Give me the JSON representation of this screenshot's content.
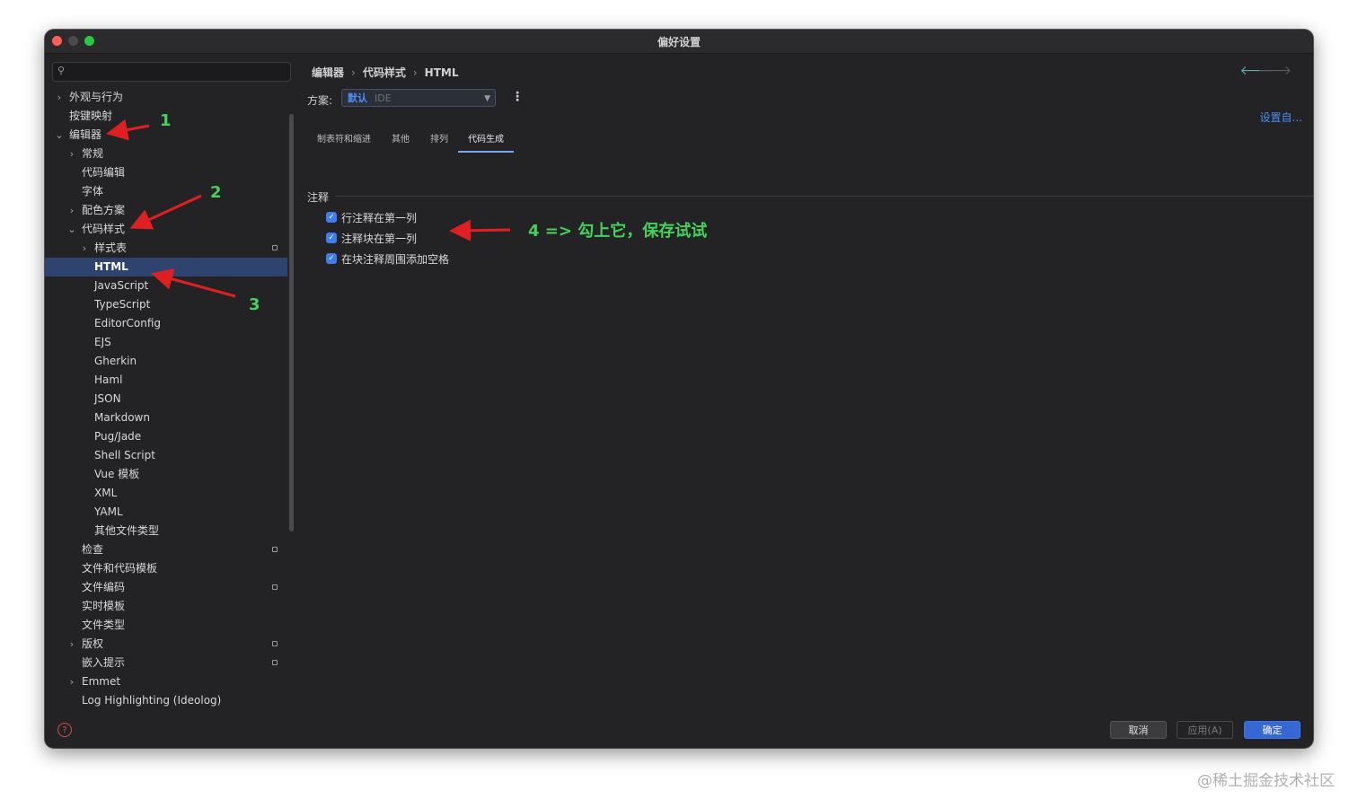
{
  "window": {
    "title": "偏好设置"
  },
  "sidebar": {
    "search": {
      "placeholder": ""
    },
    "items": [
      {
        "label": "外观与行为",
        "chevron": "right"
      },
      {
        "label": "按键映射",
        "chevron": ""
      },
      {
        "label": "编辑器",
        "chevron": "down"
      },
      {
        "label": "常规",
        "chevron": "right"
      },
      {
        "label": "代码编辑",
        "chevron": ""
      },
      {
        "label": "字体",
        "chevron": ""
      },
      {
        "label": "配色方案",
        "chevron": "right"
      },
      {
        "label": "代码样式",
        "chevron": "down"
      },
      {
        "label": "样式表",
        "chevron": "right"
      },
      {
        "label": "HTML",
        "chevron": ""
      },
      {
        "label": "JavaScript",
        "chevron": ""
      },
      {
        "label": "TypeScript",
        "chevron": ""
      },
      {
        "label": "EditorConfig",
        "chevron": ""
      },
      {
        "label": "EJS",
        "chevron": ""
      },
      {
        "label": "Gherkin",
        "chevron": ""
      },
      {
        "label": "Haml",
        "chevron": ""
      },
      {
        "label": "JSON",
        "chevron": ""
      },
      {
        "label": "Markdown",
        "chevron": ""
      },
      {
        "label": "Pug/Jade",
        "chevron": ""
      },
      {
        "label": "Shell Script",
        "chevron": ""
      },
      {
        "label": "Vue 模板",
        "chevron": ""
      },
      {
        "label": "XML",
        "chevron": ""
      },
      {
        "label": "YAML",
        "chevron": ""
      },
      {
        "label": "其他文件类型",
        "chevron": ""
      },
      {
        "label": "检查",
        "chevron": ""
      },
      {
        "label": "文件和代码模板",
        "chevron": ""
      },
      {
        "label": "文件编码",
        "chevron": ""
      },
      {
        "label": "实时模板",
        "chevron": ""
      },
      {
        "label": "文件类型",
        "chevron": ""
      },
      {
        "label": "版权",
        "chevron": "right"
      },
      {
        "label": "嵌入提示",
        "chevron": ""
      },
      {
        "label": "Emmet",
        "chevron": "right"
      },
      {
        "label": "Log Highlighting (Ideolog)",
        "chevron": ""
      }
    ],
    "selected": "HTML"
  },
  "breadcrumb": [
    "编辑器",
    "代码样式",
    "HTML"
  ],
  "scheme": {
    "label": "方案:",
    "value": "默认",
    "suffix": "IDE"
  },
  "set_from": "设置自...",
  "tabs": [
    "制表符和缩进",
    "其他",
    "排列",
    "代码生成"
  ],
  "active_tab": "代码生成",
  "section": {
    "title": "注释"
  },
  "checkboxes": [
    {
      "label": "行注释在第一列",
      "checked": true
    },
    {
      "label": "注释块在第一列",
      "checked": true
    },
    {
      "label": "在块注释周围添加空格",
      "checked": true
    }
  ],
  "footer": {
    "cancel": "取消",
    "apply": "应用(A)",
    "ok": "确定"
  },
  "annotations": {
    "n1": "1",
    "n2": "2",
    "n3": "3",
    "n4_text": "4 => 勾上它，保存试试",
    "color": "#44d25a",
    "arrow_color": "#e02020"
  },
  "watermark": "@稀土掘金技术社区",
  "colors": {
    "accent": "#3f7cf0",
    "selection": "#2e436e",
    "background": "#232325"
  }
}
